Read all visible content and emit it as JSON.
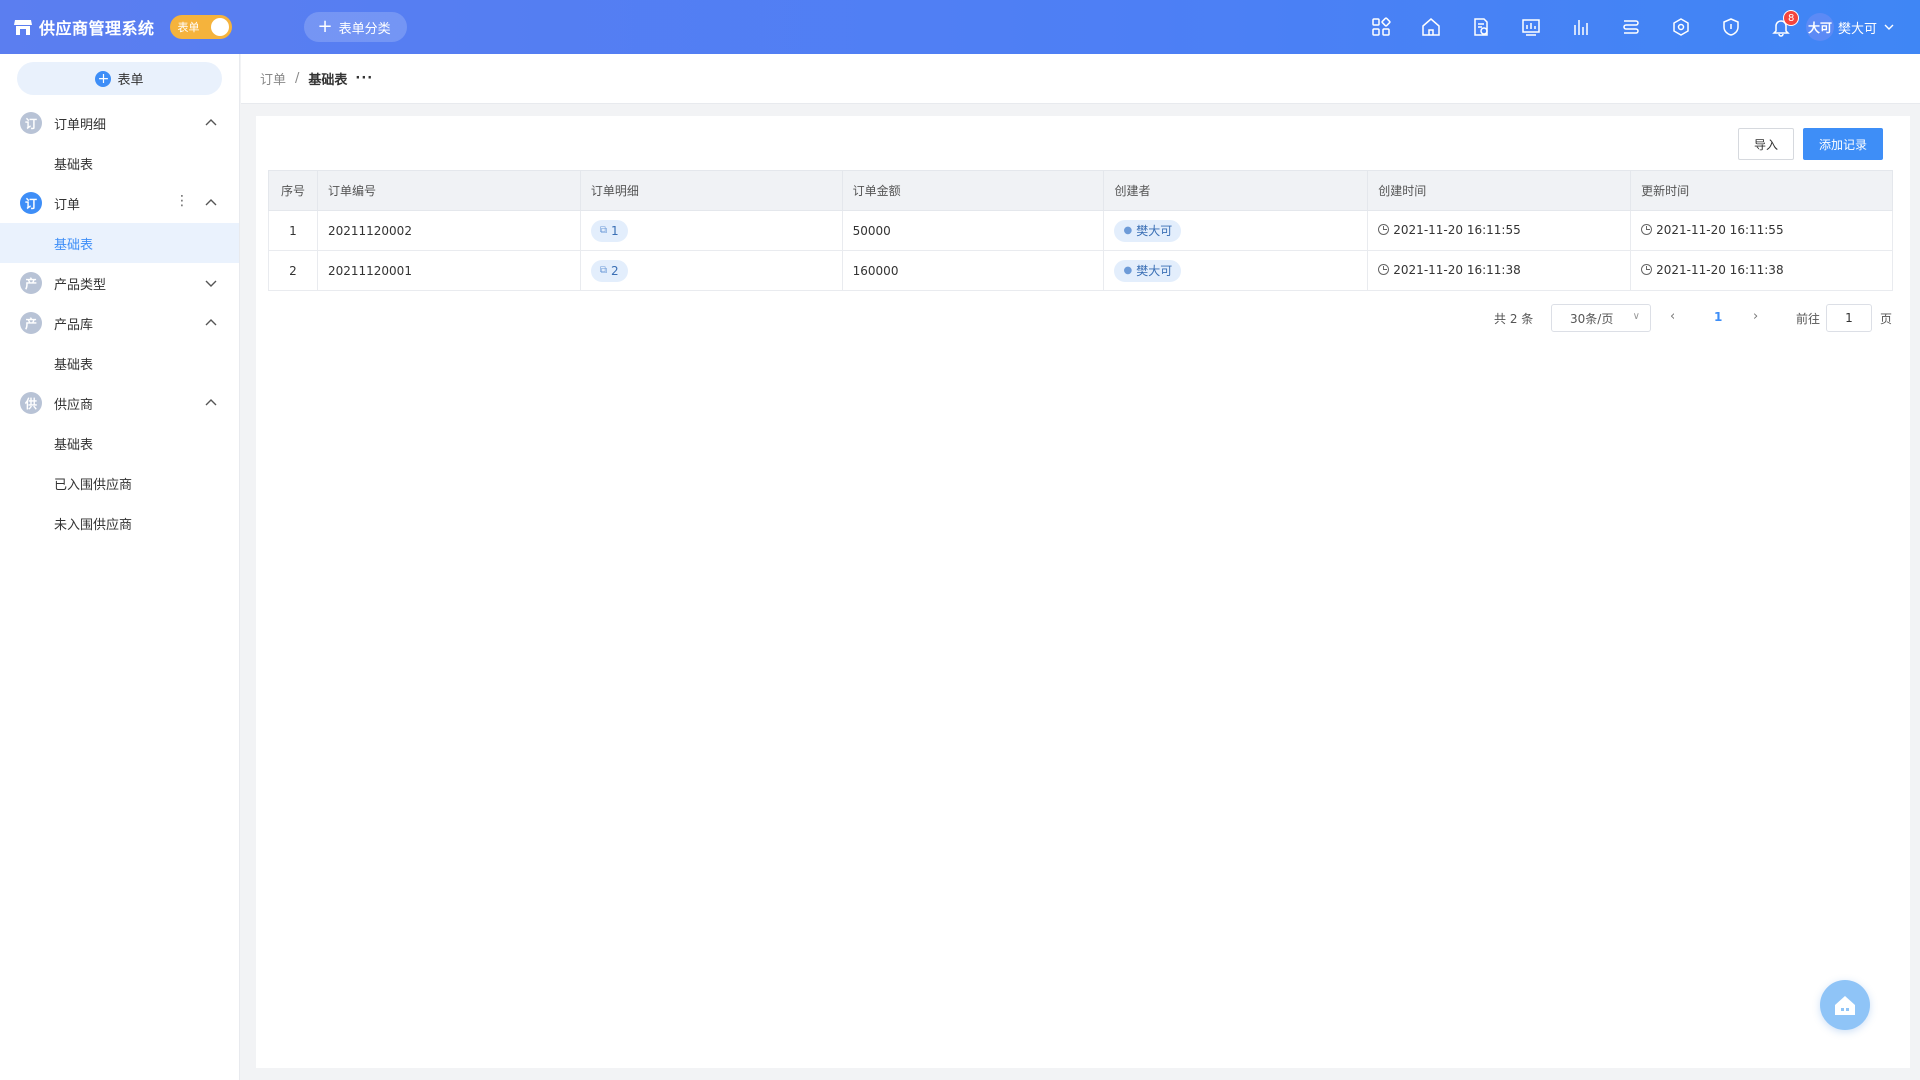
{
  "header": {
    "app_title": "供应商管理系统",
    "toggle_label": "表单",
    "category_button": "表单分类",
    "notification_count": "8",
    "user_avatar_text": "大可",
    "user_name": "樊大可",
    "icons": [
      "apps-icon",
      "home-icon",
      "document-icon",
      "chart-icon",
      "bar-chart-icon",
      "list-icon",
      "network-icon",
      "shield-icon",
      "bell-icon"
    ]
  },
  "sidebar": {
    "new_form_button": "表单",
    "groups": [
      {
        "icon_text": "订",
        "label": "订单明细",
        "items": [
          "基础表"
        ]
      },
      {
        "icon_text": "订",
        "label": "订单",
        "items": [
          "基础表"
        ]
      },
      {
        "icon_text": "产",
        "label": "产品类型",
        "items": []
      },
      {
        "icon_text": "产",
        "label": "产品库",
        "items": [
          "基础表"
        ]
      },
      {
        "icon_text": "供",
        "label": "供应商",
        "items": [
          "基础表",
          "已入围供应商",
          "未入围供应商"
        ]
      }
    ]
  },
  "breadcrumb": {
    "parent": "订单",
    "separator": "/",
    "current": "基础表",
    "more": "···"
  },
  "toolbar": {
    "import_label": "导入",
    "add_label": "添加记录"
  },
  "table": {
    "headers": [
      "序号",
      "订单编号",
      "订单明细",
      "订单金额",
      "创建者",
      "创建时间",
      "更新时间"
    ],
    "rows": [
      {
        "index": "1",
        "order_no": "20211120002",
        "detail_count": "1",
        "amount": "50000",
        "creator": "樊大可",
        "created": "2021-11-20 16:11:55",
        "updated": "2021-11-20 16:11:55"
      },
      {
        "index": "2",
        "order_no": "20211120001",
        "detail_count": "2",
        "amount": "160000",
        "creator": "樊大可",
        "created": "2021-11-20 16:11:38",
        "updated": "2021-11-20 16:11:38"
      }
    ]
  },
  "pagination": {
    "total": "共 2 条",
    "page_size": "30条/页",
    "current_page": "1",
    "goto_label": "前往",
    "goto_value": "1",
    "page_suffix": "页"
  },
  "colors": {
    "primary": "#3e8ef7",
    "header_gradient_start": "#5b7ef0",
    "toggle": "#f5b33c",
    "badge": "#f5453d"
  }
}
